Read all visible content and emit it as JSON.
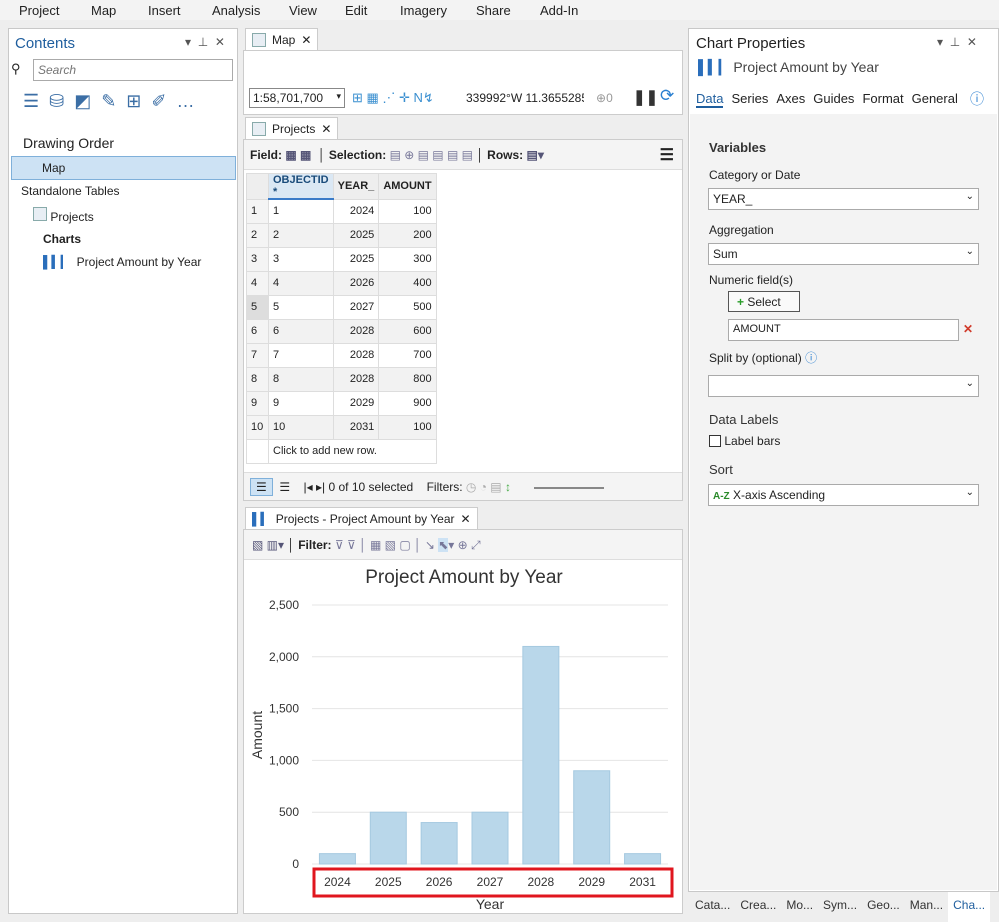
{
  "menu": [
    "Project",
    "Map",
    "Insert",
    "Analysis",
    "View",
    "Edit",
    "Imagery",
    "Share",
    "Add-In"
  ],
  "contents": {
    "title": "Contents",
    "search_placeholder": "Search",
    "drawing_order": "Drawing Order",
    "map": "Map",
    "standalone": "Standalone Tables",
    "projects": "Projects",
    "charts": "Charts",
    "chart_item": "Project Amount by Year"
  },
  "map_tab": {
    "label": "Map",
    "scale": "1:58,701,700",
    "coords": "339992°W 11.3655285°S",
    "sel_count": "0"
  },
  "table": {
    "tab": "Projects",
    "field_label": "Field:",
    "selection_label": "Selection:",
    "rows_label": "Rows:",
    "columns": [
      "OBJECTID *",
      "YEAR_",
      "AMOUNT"
    ],
    "rows": [
      [
        "1",
        "1",
        "2024",
        "100"
      ],
      [
        "2",
        "2",
        "2025",
        "200"
      ],
      [
        "3",
        "3",
        "2025",
        "300"
      ],
      [
        "4",
        "4",
        "2026",
        "400"
      ],
      [
        "5",
        "5",
        "2027",
        "500"
      ],
      [
        "6",
        "6",
        "2028",
        "600"
      ],
      [
        "7",
        "7",
        "2028",
        "700"
      ],
      [
        "8",
        "8",
        "2028",
        "800"
      ],
      [
        "9",
        "9",
        "2029",
        "900"
      ],
      [
        "10",
        "10",
        "2031",
        "100"
      ]
    ],
    "add_row": "Click to add new row.",
    "selected": "0 of 10 selected",
    "filters": "Filters:"
  },
  "chart_view": {
    "tab": "Projects - Project Amount by Year",
    "filter_label": "Filter:"
  },
  "chart_data": {
    "type": "bar",
    "title": "Project Amount by Year",
    "xlabel": "Year",
    "ylabel": "Amount",
    "categories": [
      "2024",
      "2025",
      "2026",
      "2027",
      "2028",
      "2029",
      "2031"
    ],
    "values": [
      100,
      500,
      400,
      500,
      2100,
      900,
      100
    ],
    "ylim": [
      0,
      2500
    ],
    "yticks": [
      "0",
      "500",
      "1,000",
      "1,500",
      "2,000",
      "2,500"
    ],
    "grid": true,
    "bar_color": "#b9d7ea",
    "highlight_color": "#e0161e"
  },
  "props": {
    "title": "Chart Properties",
    "subtitle": "Project Amount by Year",
    "tabs": [
      "Data",
      "Series",
      "Axes",
      "Guides",
      "Format",
      "General"
    ],
    "variables": "Variables",
    "category_label": "Category or Date",
    "category": "YEAR_",
    "aggregation_label": "Aggregation",
    "aggregation": "Sum",
    "numeric_label": "Numeric field(s)",
    "select": "Select",
    "numeric_field": "AMOUNT",
    "split_label": "Split by (optional)",
    "split": "",
    "data_labels": "Data Labels",
    "label_bars": "Label bars",
    "sort": "Sort",
    "sort_value": "X-axis Ascending",
    "sort_icon": "A-Z"
  },
  "bottom_tabs": [
    "Cata...",
    "Crea...",
    "Mo...",
    "Sym...",
    "Geo...",
    "Man...",
    "Cha..."
  ]
}
